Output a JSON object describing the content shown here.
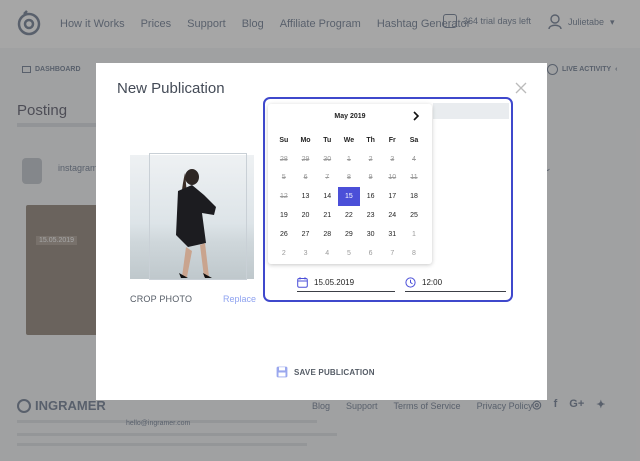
{
  "header": {
    "nav": [
      "How it Works",
      "Prices",
      "Support",
      "Blog",
      "Affiliate Program",
      "Hashtag Generator"
    ],
    "trial": "364 trial days left",
    "user": "Julietabe"
  },
  "subbar": {
    "dashboard": "DASHBOARD",
    "live_activity": "LIVE ACTIVITY"
  },
  "page": {
    "title": "Posting",
    "account": "instagram",
    "card_date": "15.05.2019"
  },
  "footer": {
    "brand": "INGRAMER",
    "links": [
      "Blog",
      "Support",
      "Terms of Service",
      "Privacy Policy"
    ],
    "email": "hello@ingramer.com"
  },
  "modal": {
    "title": "New Publication",
    "crop": "CROP PHOTO",
    "replace": "Replace",
    "save": "SAVE PUBLICATION",
    "calendar": {
      "month": "May 2019",
      "weekdays": [
        "Su",
        "Mo",
        "Tu",
        "We",
        "Th",
        "Fr",
        "Sa"
      ],
      "selected": "15",
      "weeks": [
        [
          {
            "d": "28",
            "s": "past"
          },
          {
            "d": "29",
            "s": "past"
          },
          {
            "d": "30",
            "s": "past"
          },
          {
            "d": "1",
            "s": "past"
          },
          {
            "d": "2",
            "s": "past"
          },
          {
            "d": "3",
            "s": "past"
          },
          {
            "d": "4",
            "s": "past"
          }
        ],
        [
          {
            "d": "5",
            "s": "past"
          },
          {
            "d": "6",
            "s": "past"
          },
          {
            "d": "7",
            "s": "past"
          },
          {
            "d": "8",
            "s": "past"
          },
          {
            "d": "9",
            "s": "past"
          },
          {
            "d": "10",
            "s": "past"
          },
          {
            "d": "11",
            "s": "past"
          }
        ],
        [
          {
            "d": "12",
            "s": "past"
          },
          {
            "d": "13",
            "s": ""
          },
          {
            "d": "14",
            "s": ""
          },
          {
            "d": "15",
            "s": "selected"
          },
          {
            "d": "16",
            "s": ""
          },
          {
            "d": "17",
            "s": ""
          },
          {
            "d": "18",
            "s": ""
          }
        ],
        [
          {
            "d": "19",
            "s": ""
          },
          {
            "d": "20",
            "s": ""
          },
          {
            "d": "21",
            "s": ""
          },
          {
            "d": "22",
            "s": ""
          },
          {
            "d": "23",
            "s": ""
          },
          {
            "d": "24",
            "s": ""
          },
          {
            "d": "25",
            "s": ""
          }
        ],
        [
          {
            "d": "26",
            "s": ""
          },
          {
            "d": "27",
            "s": ""
          },
          {
            "d": "28",
            "s": ""
          },
          {
            "d": "29",
            "s": ""
          },
          {
            "d": "30",
            "s": ""
          },
          {
            "d": "31",
            "s": ""
          },
          {
            "d": "1",
            "s": "muted"
          }
        ],
        [
          {
            "d": "2",
            "s": "muted"
          },
          {
            "d": "3",
            "s": "muted"
          },
          {
            "d": "4",
            "s": "muted"
          },
          {
            "d": "5",
            "s": "muted"
          },
          {
            "d": "6",
            "s": "muted"
          },
          {
            "d": "7",
            "s": "muted"
          },
          {
            "d": "8",
            "s": "muted"
          }
        ]
      ]
    },
    "date_value": "15.05.2019",
    "time_value": "12:00"
  },
  "colors": {
    "accent": "#4b4fd8",
    "highlight": "#3f48cc"
  }
}
